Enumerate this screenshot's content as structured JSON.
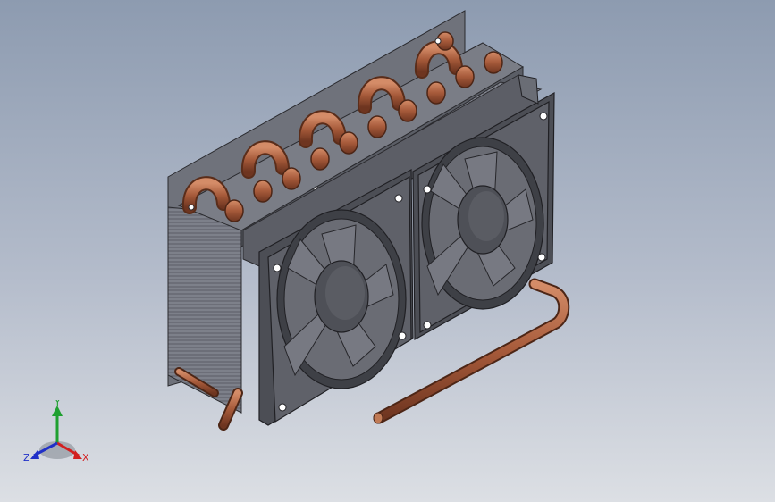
{
  "viewport": {
    "model": "cooling-unit-heat-exchanger-with-two-fans",
    "colors": {
      "background_top": "#8d9bb0",
      "background_bottom": "#dcdfe4",
      "fan_housing": "#5e6068",
      "fan_dark": "#45474e",
      "fins": "#7c7f88",
      "copper": "#a65a3a",
      "copper_highlight": "#d48c68",
      "bracket": "#6f727b"
    }
  },
  "triad": {
    "x_label": "X",
    "y_label": "Y",
    "z_label": "Z",
    "x_color": "#d22020",
    "y_color": "#1fa030",
    "z_color": "#2030c8"
  }
}
